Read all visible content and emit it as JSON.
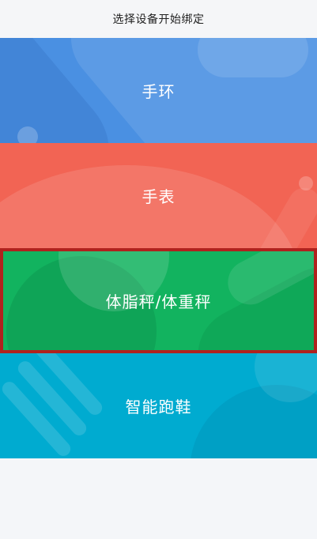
{
  "header": {
    "title": "选择设备开始绑定"
  },
  "devices": [
    {
      "label": "手环",
      "color": "#4a90e2",
      "selected": false
    },
    {
      "label": "手表",
      "color": "#f26454",
      "selected": false
    },
    {
      "label": "体脂秤/体重秤",
      "color": "#12b35f",
      "selected": true,
      "highlight_border": "#b0221e"
    },
    {
      "label": "智能跑鞋",
      "color": "#00abd0",
      "selected": false
    }
  ]
}
